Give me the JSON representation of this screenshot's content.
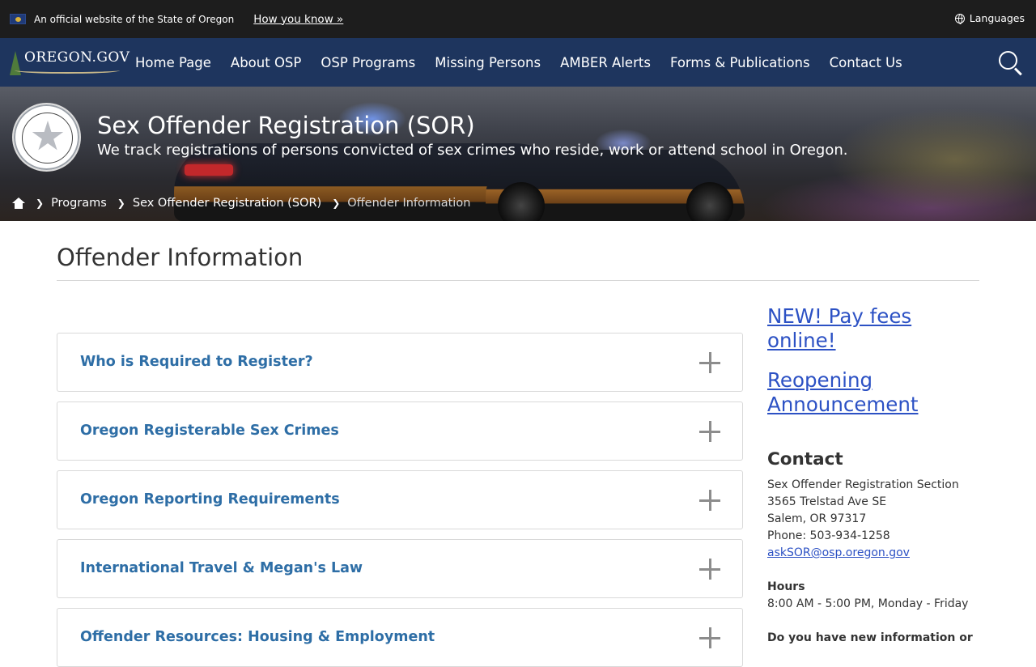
{
  "banner": {
    "official_text": "An official website of the State of Oregon",
    "how_you_know": "How you know »",
    "languages": "Languages"
  },
  "nav": {
    "logo_text": "OREGON.GOV",
    "items": [
      {
        "label": "Home Page"
      },
      {
        "label": "About OSP"
      },
      {
        "label": "OSP Programs"
      },
      {
        "label": "Missing Persons"
      },
      {
        "label": "AMBER Alerts"
      },
      {
        "label": "Forms & Publications"
      },
      {
        "label": "Contact Us"
      }
    ]
  },
  "hero": {
    "title": "Sex Offender Registration (SOR)",
    "subtitle": "We track registrations of persons convicted of sex crimes who reside, work or attend school in Oregon.",
    "breadcrumbs": [
      "Programs",
      "Sex Offender Registration (SOR)",
      "Offender Information"
    ]
  },
  "page": {
    "title": "Offender Information"
  },
  "accordion": [
    {
      "label": "Who is Required to Register?"
    },
    {
      "label": "Oregon Registerable Sex Crimes"
    },
    {
      "label": "Oregon Reporting Requirements"
    },
    {
      "label": "International Travel & Megan's Law"
    },
    {
      "label": "Offender Resources: Housing & Employment"
    }
  ],
  "sidebar": {
    "links": [
      "NEW! Pay fees online!",
      "Reopening Announcement"
    ],
    "contact_heading": "Contact",
    "contact_lines": [
      "Sex Offender Registration Section",
      "3565 Trelstad Ave SE",
      "Salem, OR 97317",
      "Phone: 503-934-1258"
    ],
    "email": "askSOR@osp.oregon.gov",
    "hours_heading": "Hours",
    "hours": "8:00 AM - 5:00 PM, Monday - Friday",
    "new_info": "Do you have new information or"
  },
  "colors": {
    "topbar": "#1d1d1d",
    "nav": "#1e355e",
    "accordion_text": "#2e6ea6",
    "link": "#2c51c4"
  }
}
